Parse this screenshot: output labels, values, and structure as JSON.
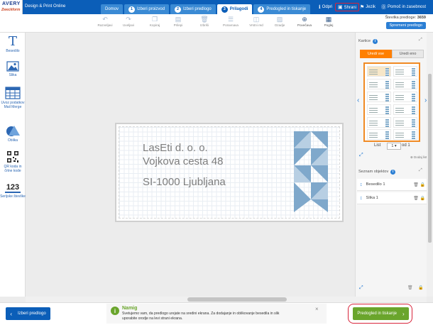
{
  "app": {
    "brand_line1": "AVERY",
    "brand_line2": "Zweckform",
    "name": "Design & Print Online"
  },
  "steps": [
    {
      "num": "",
      "label": "Domov"
    },
    {
      "num": "1",
      "label": "Izberi proizvod"
    },
    {
      "num": "2",
      "label": "Izberi predlogo"
    },
    {
      "num": "3",
      "label": "Prilagodi"
    },
    {
      "num": "4",
      "label": "Predogled in tiskanje"
    }
  ],
  "top_actions": {
    "open": "Odpri",
    "save": "Shrani",
    "language": "Jezik",
    "help": "Pomoč in zasebnost"
  },
  "toolbar": {
    "tools": [
      "Razveljavi",
      "Uveljavi",
      "Kopiraj",
      "Prilepi",
      "Izbriši",
      "Poravnava",
      "Vrstni red",
      "Ozadje",
      "Povečava",
      "Poglej"
    ],
    "template_number_label": "Številka predloge:",
    "template_number": "3659",
    "save_template": "Spremeni predlogo"
  },
  "left_tools": [
    {
      "icon": "text-icon",
      "label": "Besedilo"
    },
    {
      "icon": "image-icon",
      "label": "Slika"
    },
    {
      "icon": "table-icon",
      "label": "Uvoz podatkov Mail Merge"
    },
    {
      "icon": "shapes-icon",
      "label": "Oblika"
    },
    {
      "icon": "qr-code-icon",
      "label": "QR koda in črtne kode"
    },
    {
      "icon": "numbering-icon",
      "label": "Serijske številke",
      "glyph": "123"
    }
  ],
  "label_content": {
    "line1": "LasEti d. o. o.",
    "line2": "Vojkova cesta 48",
    "line3": "SI-1000 Ljubljana"
  },
  "right_panel": {
    "kartice_title": "Kartice",
    "tab_all": "Uredi vse",
    "tab_one": "Uredi eno",
    "sheet_label": "List",
    "sheet_value": "1",
    "sheet_of": "od 1",
    "add_sheet": "Dodaj list",
    "objects_title": "Seznam objektov",
    "objects": [
      {
        "name": "Besedilo 1"
      },
      {
        "name": "Slika 1"
      }
    ]
  },
  "hint": {
    "title": "Namig",
    "body": "Svetujemo vam, da predlogo urejate na sredini ekrana. Za dodajanje in oblikovanje besedila in slik uporabite orodje na levi strani ekrana."
  },
  "bottom": {
    "back": "Izberi predlogo",
    "next": "Predogled in tiskanje"
  },
  "colors": {
    "brand_blue": "#0b5eb8",
    "accent_orange": "#ff7f00",
    "primary_green": "#6aa52c",
    "highlight_red": "#d8243a"
  }
}
